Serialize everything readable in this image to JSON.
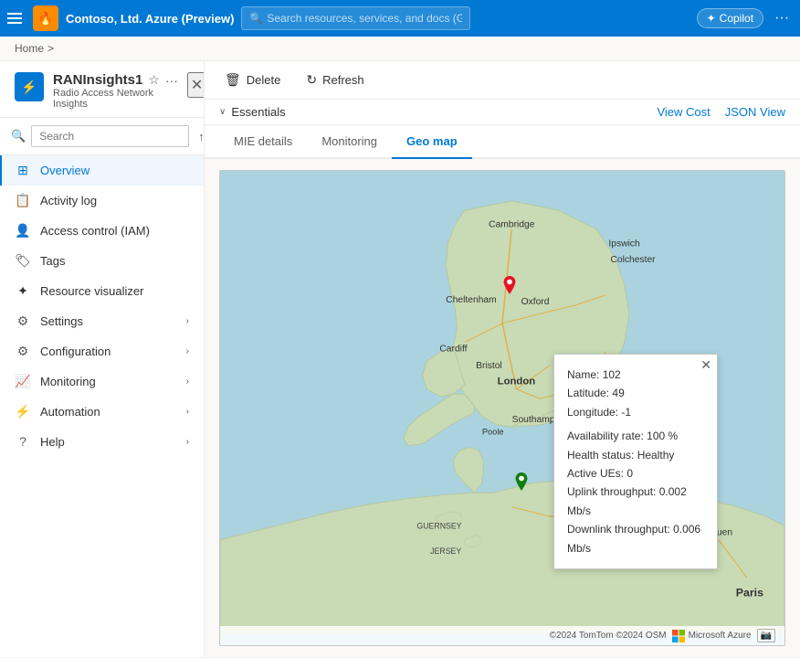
{
  "topbar": {
    "title": "Contoso, Ltd. Azure (Preview)",
    "search_placeholder": "Search resources, services, and docs (G+/)",
    "copilot_label": "Copilot"
  },
  "breadcrumb": {
    "home": "Home",
    "separator": ">"
  },
  "sidebar": {
    "resource_icon": "⚡",
    "title": "RANInsights1",
    "subtitle": "Radio Access Network Insights",
    "search_placeholder": "Search",
    "nav_items": [
      {
        "id": "overview",
        "label": "Overview",
        "icon": "⊞",
        "active": true,
        "expandable": false
      },
      {
        "id": "activity-log",
        "label": "Activity log",
        "icon": "📋",
        "active": false,
        "expandable": false
      },
      {
        "id": "access-control",
        "label": "Access control (IAM)",
        "icon": "👤",
        "active": false,
        "expandable": false
      },
      {
        "id": "tags",
        "label": "Tags",
        "icon": "🏷",
        "active": false,
        "expandable": false
      },
      {
        "id": "resource-visualizer",
        "label": "Resource visualizer",
        "icon": "✦",
        "active": false,
        "expandable": false
      },
      {
        "id": "settings",
        "label": "Settings",
        "icon": "",
        "active": false,
        "expandable": true
      },
      {
        "id": "configuration",
        "label": "Configuration",
        "icon": "",
        "active": false,
        "expandable": true
      },
      {
        "id": "monitoring",
        "label": "Monitoring",
        "icon": "",
        "active": false,
        "expandable": true
      },
      {
        "id": "automation",
        "label": "Automation",
        "icon": "",
        "active": false,
        "expandable": true
      },
      {
        "id": "help",
        "label": "Help",
        "icon": "",
        "active": false,
        "expandable": true
      }
    ]
  },
  "toolbar": {
    "delete_label": "Delete",
    "refresh_label": "Refresh"
  },
  "essentials": {
    "label": "Essentials",
    "view_cost": "View Cost",
    "json_view": "JSON View"
  },
  "tabs": [
    {
      "id": "mie-details",
      "label": "MIE details",
      "active": false
    },
    {
      "id": "monitoring",
      "label": "Monitoring",
      "active": false
    },
    {
      "id": "geo-map",
      "label": "Geo map",
      "active": true
    }
  ],
  "map": {
    "popup": {
      "name_label": "Name:",
      "name_value": "102",
      "lat_label": "Latitude:",
      "lat_value": "49",
      "lon_label": "Longitude:",
      "lon_value": "-1",
      "avail_label": "Availability rate:",
      "avail_value": "100 %",
      "health_label": "Health status:",
      "health_value": "Healthy",
      "ues_label": "Active UEs:",
      "ues_value": "0",
      "uplink_label": "Uplink throughput:",
      "uplink_value": "0.002 Mb/s",
      "downlink_label": "Downlink throughput:",
      "downlink_value": "0.006 Mb/s"
    },
    "footer": "©2024 TomTom ©2024 OSM",
    "footer_azure": "Microsoft Azure"
  }
}
